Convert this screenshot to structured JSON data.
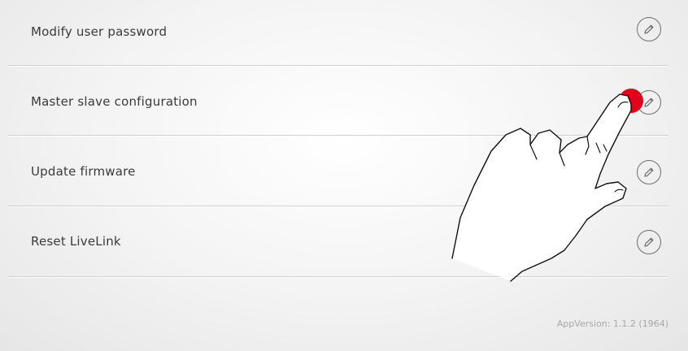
{
  "settings": {
    "items": [
      {
        "label": "Modify user password",
        "icon": "pencil-icon"
      },
      {
        "label": "Master slave configuration",
        "icon": "pencil-icon"
      },
      {
        "label": "Update firmware",
        "icon": "pencil-icon"
      },
      {
        "label": "Reset LiveLink",
        "icon": "pencil-icon"
      }
    ]
  },
  "footer": {
    "app_version": "AppVersion: 1.1.2 (1964)"
  },
  "overlay": {
    "tap_indicator_color": "#e3001b",
    "icon": "tapping-hand-icon"
  }
}
